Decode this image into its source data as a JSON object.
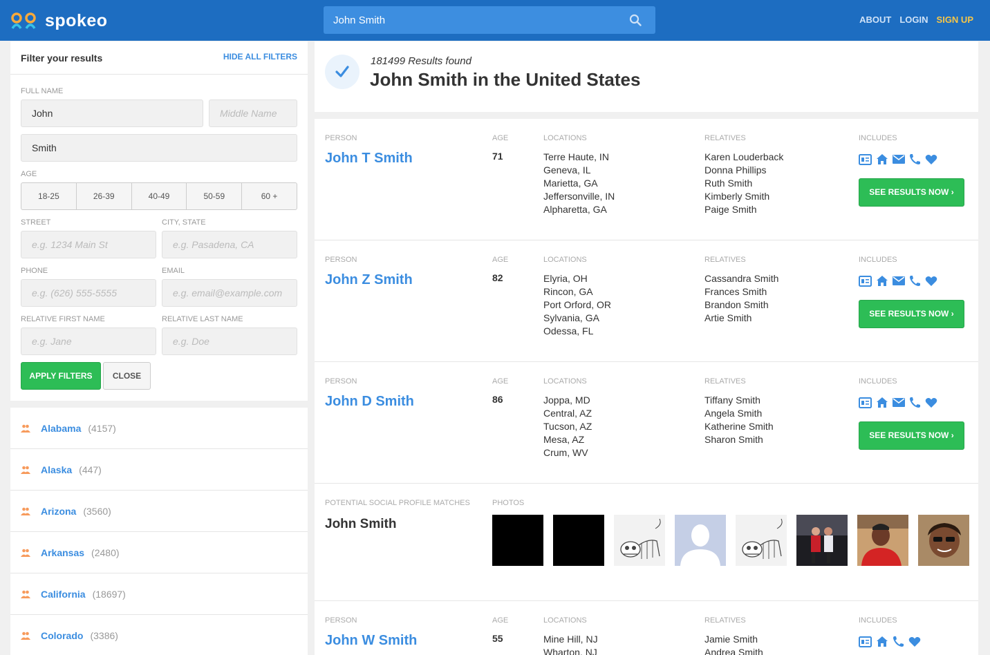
{
  "header": {
    "logo_text": "spokeo",
    "search_value": "John Smith",
    "nav": {
      "about": "ABOUT",
      "login": "LOGIN",
      "signup": "SIGN UP"
    },
    "colors": {
      "bar": "#1d6dc1",
      "search": "#3d8ee0",
      "signup": "#f7c647"
    }
  },
  "filters": {
    "title": "Filter your results",
    "hide_all": "HIDE ALL FILTERS",
    "full_name_label": "FULL NAME",
    "first_name": "John",
    "middle_placeholder": "Middle Name",
    "last_name": "Smith",
    "age_label": "AGE",
    "age_ranges": [
      "18-25",
      "26-39",
      "40-49",
      "50-59",
      "60 +"
    ],
    "street_label": "STREET",
    "street_placeholder": "e.g. 1234 Main St",
    "city_label": "CITY, STATE",
    "city_placeholder": "e.g. Pasadena, CA",
    "phone_label": "PHONE",
    "phone_placeholder": "e.g. (626) 555-5555",
    "email_label": "EMAIL",
    "email_placeholder": "e.g. email@example.com",
    "rel_first_label": "RELATIVE FIRST NAME",
    "rel_first_placeholder": "e.g. Jane",
    "rel_last_label": "RELATIVE LAST NAME",
    "rel_last_placeholder": "e.g. Doe",
    "apply": "APPLY FILTERS",
    "close": "CLOSE"
  },
  "states": [
    {
      "name": "Alabama",
      "count": "(4157)"
    },
    {
      "name": "Alaska",
      "count": "(447)"
    },
    {
      "name": "Arizona",
      "count": "(3560)"
    },
    {
      "name": "Arkansas",
      "count": "(2480)"
    },
    {
      "name": "California",
      "count": "(18697)"
    },
    {
      "name": "Colorado",
      "count": "(3386)"
    }
  ],
  "summary": {
    "count_text": "181499 Results found",
    "title": "John Smith in the United States"
  },
  "column_labels": {
    "person": "PERSON",
    "age": "AGE",
    "locations": "LOCATIONS",
    "relatives": "RELATIVES",
    "includes": "INCLUDES",
    "social": "POTENTIAL SOCIAL PROFILE MATCHES",
    "photos": "PHOTOS"
  },
  "see_results": "SEE RESULTS NOW ›",
  "results": [
    {
      "name": "John T Smith",
      "age": "71",
      "locations": [
        "Terre Haute, IN",
        "Geneva, IL",
        "Marietta, GA",
        "Jeffersonville, IN",
        "Alpharetta, GA"
      ],
      "relatives": [
        "Karen Louderback",
        "Donna Phillips",
        "Ruth Smith",
        "Kimberly Smith",
        "Paige Smith"
      ],
      "includes": [
        "id-card-icon",
        "home-icon",
        "email-icon",
        "phone-icon",
        "heart-icon"
      ]
    },
    {
      "name": "John Z Smith",
      "age": "82",
      "locations": [
        "Elyria, OH",
        "Rincon, GA",
        "Port Orford, OR",
        "Sylvania, GA",
        "Odessa, FL"
      ],
      "relatives": [
        "Cassandra Smith",
        "Frances Smith",
        "Brandon Smith",
        "Artie Smith"
      ],
      "includes": [
        "id-card-icon",
        "home-icon",
        "email-icon",
        "phone-icon",
        "heart-icon"
      ]
    },
    {
      "name": "John D Smith",
      "age": "86",
      "locations": [
        "Joppa, MD",
        "Central, AZ",
        "Tucson, AZ",
        "Mesa, AZ",
        "Crum, WV"
      ],
      "relatives": [
        "Tiffany Smith",
        "Angela Smith",
        "Katherine Smith",
        "Sharon Smith"
      ],
      "includes": [
        "id-card-icon",
        "home-icon",
        "email-icon",
        "phone-icon",
        "heart-icon"
      ]
    }
  ],
  "social": {
    "name": "John Smith",
    "photos": [
      "black-photo",
      "black-photo",
      "skeleton-drawing-photo",
      "default-avatar-photo",
      "skeleton-drawing-photo",
      "couple-photo",
      "person-red-shirt-photo",
      "person-sunglasses-photo"
    ]
  },
  "partial_result": {
    "name": "John W Smith",
    "age": "55",
    "locations": [
      "Mine Hill, NJ",
      "Wharton, NJ"
    ],
    "relatives": [
      "Jamie Smith",
      "Andrea Smith"
    ],
    "includes": [
      "id-card-icon",
      "home-icon",
      "phone-icon",
      "heart-icon"
    ]
  }
}
